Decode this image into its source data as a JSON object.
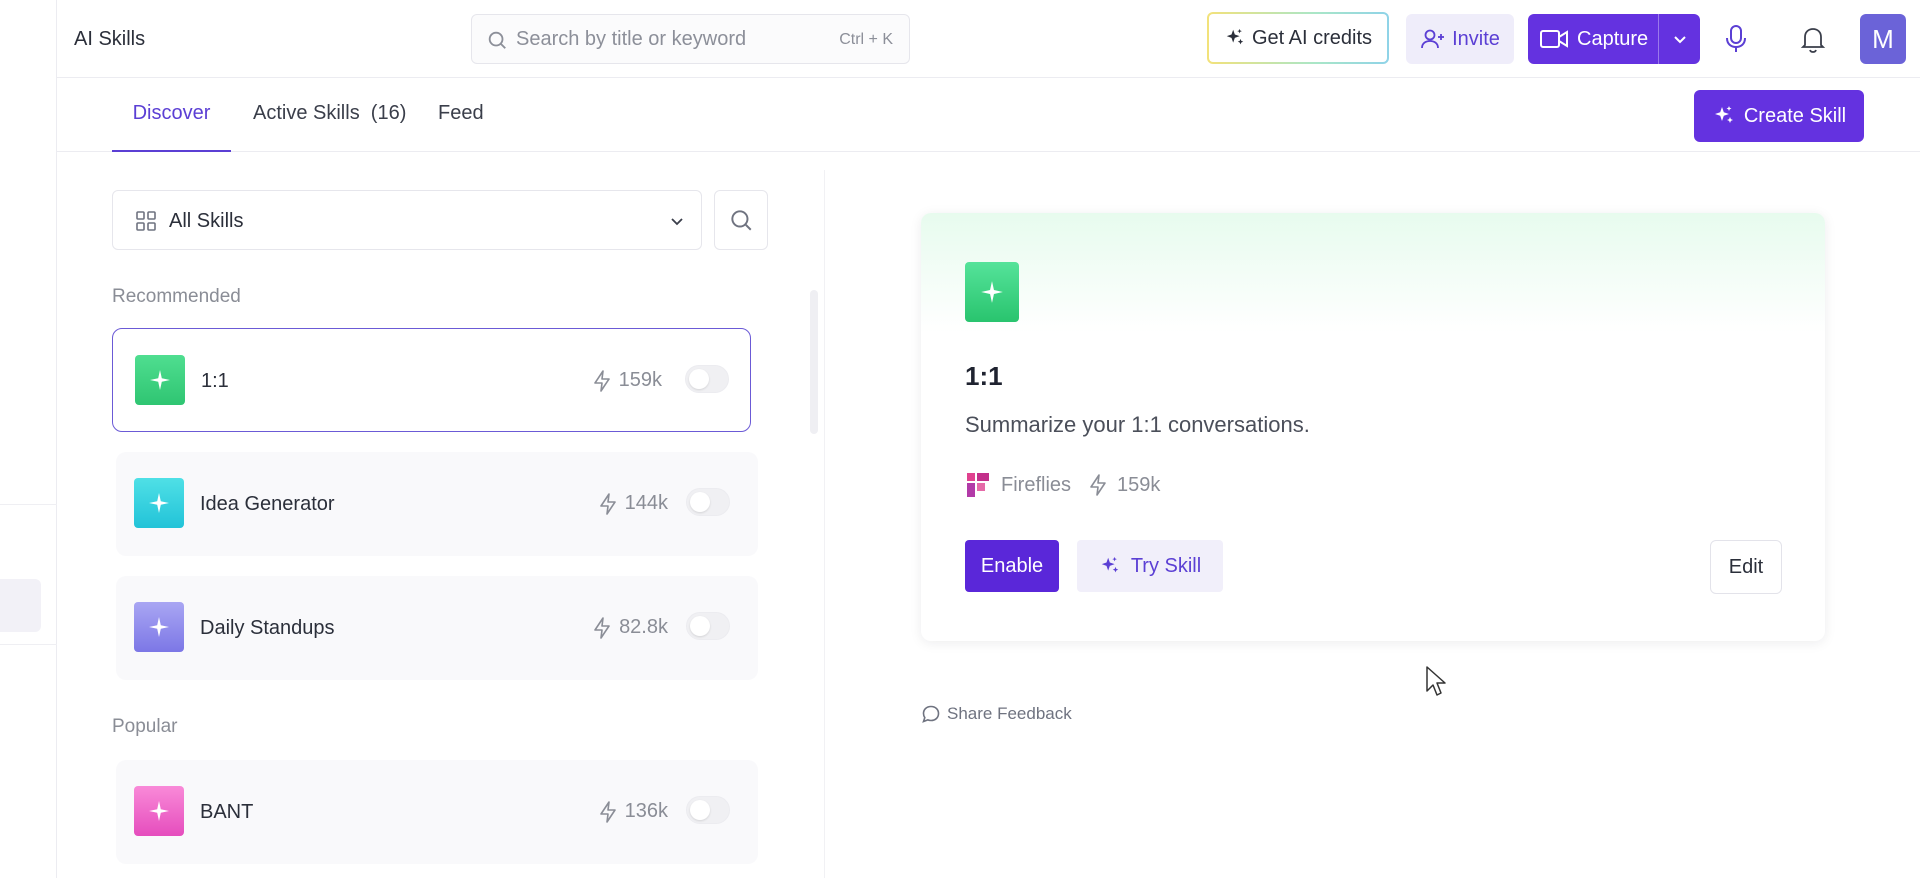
{
  "header": {
    "app_title": "AI Skills",
    "search_placeholder": "Search by title or keyword",
    "search_shortcut": "Ctrl + K",
    "credits_label": "Get AI credits",
    "invite_label": "Invite",
    "capture_label": "Capture",
    "avatar_initial": "M"
  },
  "tabs": [
    {
      "label": "Discover",
      "active": true
    },
    {
      "label": "Active Skills  (16)",
      "active": false
    },
    {
      "label": "Feed",
      "active": false
    }
  ],
  "create_skill_label": "Create Skill",
  "filter": {
    "selected": "All Skills"
  },
  "sections": {
    "recommended": "Recommended",
    "popular": "Popular"
  },
  "recommended": [
    {
      "name": "1:1",
      "count": "159k",
      "enabled": false,
      "gradient": [
        "#4fde90",
        "#2fc572"
      ]
    },
    {
      "name": "Idea Generator",
      "count": "144k",
      "enabled": false,
      "gradient": [
        "#4fe0e6",
        "#22c3d8"
      ]
    },
    {
      "name": "Daily Standups",
      "count": "82.8k",
      "enabled": false,
      "gradient": [
        "#a9a6f3",
        "#7c77e6"
      ]
    }
  ],
  "popular": [
    {
      "name": "BANT",
      "count": "136k",
      "enabled": false,
      "gradient": [
        "#f98ad8",
        "#e54dbd"
      ]
    }
  ],
  "detail": {
    "title": "1:1",
    "description": "Summarize your 1:1 conversations.",
    "author": "Fireflies",
    "count": "159k",
    "enable_label": "Enable",
    "try_label": "Try Skill",
    "edit_label": "Edit"
  },
  "feedback_label": "Share Feedback",
  "colors": {
    "accent": "#6432e0",
    "accent_soft": "#efedfa"
  },
  "icons": [
    "search-icon",
    "sparkle-icon",
    "user-plus-icon",
    "video-icon",
    "chevron-down-icon",
    "mic-icon",
    "bell-icon",
    "grid-icon",
    "bolt-icon",
    "fireflies-logo-icon",
    "chat-bubble-icon"
  ]
}
